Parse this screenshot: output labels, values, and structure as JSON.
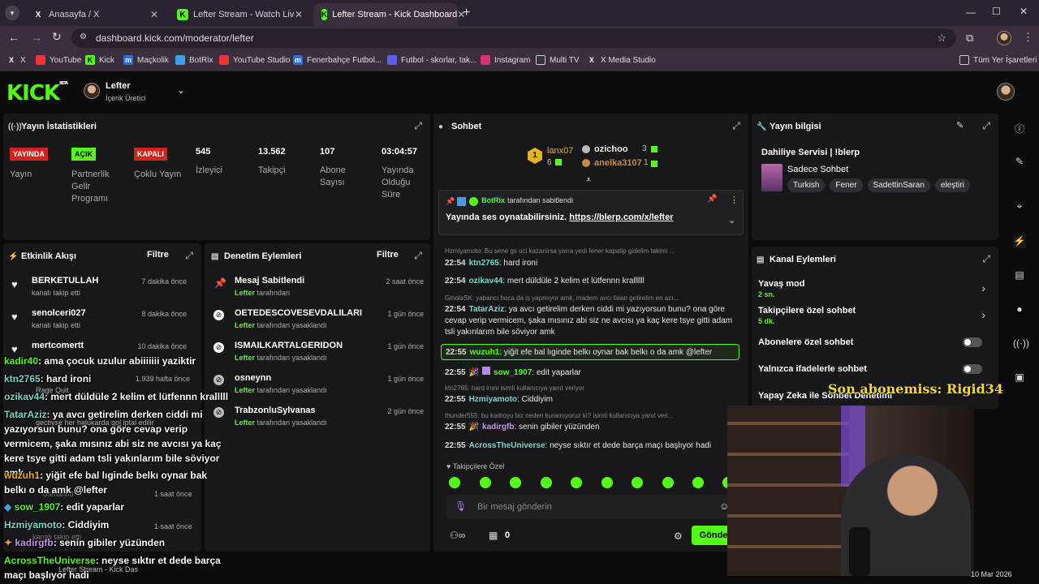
{
  "browser": {
    "tabs": [
      {
        "label": "Anasayfa / X",
        "favicon": "x-icon"
      },
      {
        "label": "Lefter Stream - Watch Live on K",
        "favicon": "kick-icon"
      },
      {
        "label": "Lefter Stream - Kick Dashboard",
        "favicon": "kick-icon"
      }
    ],
    "url": "dashboard.kick.com/moderator/lefter",
    "bookmarks": [
      "X",
      "YouTube",
      "Kick",
      "Maçkolik",
      "BotRix",
      "YouTube Studio",
      "Fenerbahçe Futbol...",
      "Futbol - skorlar, tak...",
      "Instagram",
      "Multi TV",
      "X Media Studio"
    ],
    "all_bookmarks": "Tüm Yer İşaretleri"
  },
  "header": {
    "logo": "KICK",
    "logo_sup": "BETA",
    "user_name": "Lefter",
    "user_role": "İçerik Üretici"
  },
  "stats": {
    "title": "Yayın İstatistikleri",
    "items": [
      {
        "badge": "YAYINDA",
        "label": "Yayın",
        "color": "#d4231b"
      },
      {
        "badge": "AÇIK",
        "label": "Partnerlik Gelir Programı",
        "color": "#53fc18"
      },
      {
        "badge": "KAPALI",
        "label": "Çoklu Yayın",
        "color": "#d4231b"
      },
      {
        "value": "545",
        "label": "İzleyici"
      },
      {
        "value": "13.562",
        "label": "Takipçi"
      },
      {
        "value": "107",
        "label": "Abone Sayısı"
      },
      {
        "value": "03:04:57",
        "label": "Yayında Olduğu Süre"
      }
    ]
  },
  "activity": {
    "title": "Etkinlik Akışı",
    "filter": "Filtre",
    "items": [
      {
        "name": "BERKETULLAH",
        "sub": "kanalı takip etti",
        "time": "7 dakika önce"
      },
      {
        "name": "senolceri027",
        "sub": "kanalı takip etti",
        "time": "8 dakika önce"
      },
      {
        "name": "mertcomertt",
        "sub": "",
        "time": "10 dakika önce"
      },
      {
        "name": "",
        "sub": "",
        "time": "1.939 hafta önce"
      },
      {
        "name": "Rage Quit",
        "sub": "",
        "time": ""
      },
      {
        "name": "gectiyse her halukarda gol iptal edilir",
        "sub": "",
        "time": ""
      },
      {
        "name": "Osmanlı8",
        "sub": "",
        "time": "1 saat önce"
      },
      {
        "name": "",
        "sub": "kanalı takip etti",
        "time": "1 saat önce"
      }
    ]
  },
  "moderation": {
    "title": "Denetim Eylemleri",
    "filter": "Filtre",
    "items": [
      {
        "name": "Mesaj Sabitlendi",
        "by": "Lefter",
        "sub": "tarafından",
        "time": "2 saat önce"
      },
      {
        "name": "OETEDESCOVESEVDALILARI",
        "by": "Lefter",
        "sub": "tarafından yasaklandı",
        "time": "1 gün önce"
      },
      {
        "name": "ISMAILKARTALGERIDON",
        "by": "Lefter",
        "sub": "tarafından yasaklandı",
        "time": "1 gün önce"
      },
      {
        "name": "osneynn",
        "by": "Lefter",
        "sub": "tarafından yasaklandı",
        "time": "1 gün önce"
      },
      {
        "name": "TrabzonluSylvanas",
        "by": "Lefter",
        "sub": "tarafından yasaklandı",
        "time": "2 gün önce"
      }
    ]
  },
  "chat": {
    "title": "Sohbet",
    "leaders": [
      {
        "rank": "1",
        "name": "lanx07",
        "count": "6"
      },
      {
        "name": "ozichoo",
        "count": "3"
      },
      {
        "name": "anelka3107",
        "count": "1"
      }
    ],
    "pinned": {
      "by_user": "BotRix",
      "by_text": "tarafından sabitlendi",
      "text": "Yayında ses oynatabilirsiniz.",
      "link": "https://blerp.com/x/lefter"
    },
    "messages": [
      {
        "reply": "Hzmiyamoto: Bu sene gs uci kazanirsa yarra yedi fener kapatip gidelim takimi ..."
      },
      {
        "time": "22:54",
        "user": "ktn2765",
        "color": "#7ad6c8",
        "text": "hard ironi"
      },
      {
        "time": "22:54",
        "user": "ozikav44",
        "color": "#7ad6c8",
        "text": "mert düldüle 2 kelim et lütfennn krallllll"
      },
      {
        "reply": "GinolaSK: yabancı hoca da iş yapmıyor amk, madem avcı falan getirelim en azı..."
      },
      {
        "time": "22:54",
        "user": "TatarAziz",
        "color": "#7ad6c8",
        "text": "ya avcı getirelim derken ciddi mi yazıyorsun bunu? ona göre cevap verip vermicem, şaka mısınız abi siz ne avcısı ya kaç kere tsye gitti adam tsli yakınlarım bile söviyor amk"
      },
      {
        "time": "22:55",
        "user": "wuzuh1",
        "color": "#53fc18",
        "text": "yiğit efe bal lıginde belkı oynar bak belkı o da amk @lefter",
        "highlight": true
      },
      {
        "time": "22:55",
        "user": "sow_1907",
        "color": "#53fc18",
        "text": "edit yaparlar"
      },
      {
        "reply": "ktn2765: hard ironi isimli kullanıcıya yanıt veriyor"
      },
      {
        "time": "22:55",
        "user": "Hzmiyamoto",
        "color": "#7ad6c8",
        "text": "Ciddiyim"
      },
      {
        "reply": "thunder555: bu kadroyu biz neden kuramıyoruz ki? isimli kullanıcıya yanıt veri..."
      },
      {
        "time": "22:55",
        "user": "kadirgfb",
        "color": "#c792ea",
        "text": "senin gibiler yüzünden"
      },
      {
        "time": "22:55",
        "user": "AcrossTheUniverse",
        "color": "#7ad6c8",
        "text": "neyse sıktır et dede barça maçı başlıyor hadi"
      }
    ],
    "followers_only": "Takipçilere Özel",
    "input_placeholder": "Bir mesaj gönderin",
    "points": "0",
    "send": "Gönde"
  },
  "stream_info": {
    "title": "Yayın bilgisi",
    "stream_title": "Dahiliye Servisi | !blerp",
    "category": "Sadece Sohbet",
    "tags": [
      "Turkish",
      "Fener",
      "SadettinSaran",
      "eleştiri"
    ]
  },
  "channel_actions": {
    "title": "Kanal Eylemleri",
    "items": [
      {
        "label": "Yavaş mod",
        "sub": "2 sn."
      },
      {
        "label": "Takipçilere özel sohbet",
        "sub": "5 dk."
      },
      {
        "label": "Abonelere özel sohbet"
      },
      {
        "label": "Yalnızca ifadelerle sohbet"
      },
      {
        "label": "Yapay Zeka ile Sohbet Denetimi"
      }
    ]
  },
  "overlay": {
    "sub_alert": "Son abonemiss: Rigid34",
    "chat": [
      {
        "user": "kadir40",
        "text": ": ama çocuk uzulur abiiiiiii yaziktir"
      },
      {
        "user": "ktn2765",
        "text": ": hard ironi"
      },
      {
        "user": "ozikav44",
        "text": ": mert düldüle 2 kelim et lütfennn kralllll"
      },
      {
        "user": "TatarAziz",
        "text": ": ya avcı getirelim derken ciddi mi yazıyorsun bunu? ona göre cevap verip vermicem, şaka mısınız abi siz ne avcısı ya kaç kere tsye gitti adam tsli yakınlarım bile söviyor amk"
      },
      {
        "user": "wuzuh1",
        "text": ": yiğit efe bal lıginde belkı oynar bak belkı o da amk @lefter"
      },
      {
        "user": "sow_1907",
        "text": ": edit yaparlar"
      },
      {
        "user": "Hzmiyamoto",
        "text": ": Ciddiyim"
      },
      {
        "user": "kadirgfb",
        "text": ": senin gibiler yüzünden"
      },
      {
        "user": "AcrossTheUniverse",
        "text": ": neyse sıktır et dede barça maçı başlıyor hadi"
      }
    ]
  },
  "taskbar": {
    "item": "Lefter Stream - Kick Das",
    "date": "10 Mar 2026"
  }
}
